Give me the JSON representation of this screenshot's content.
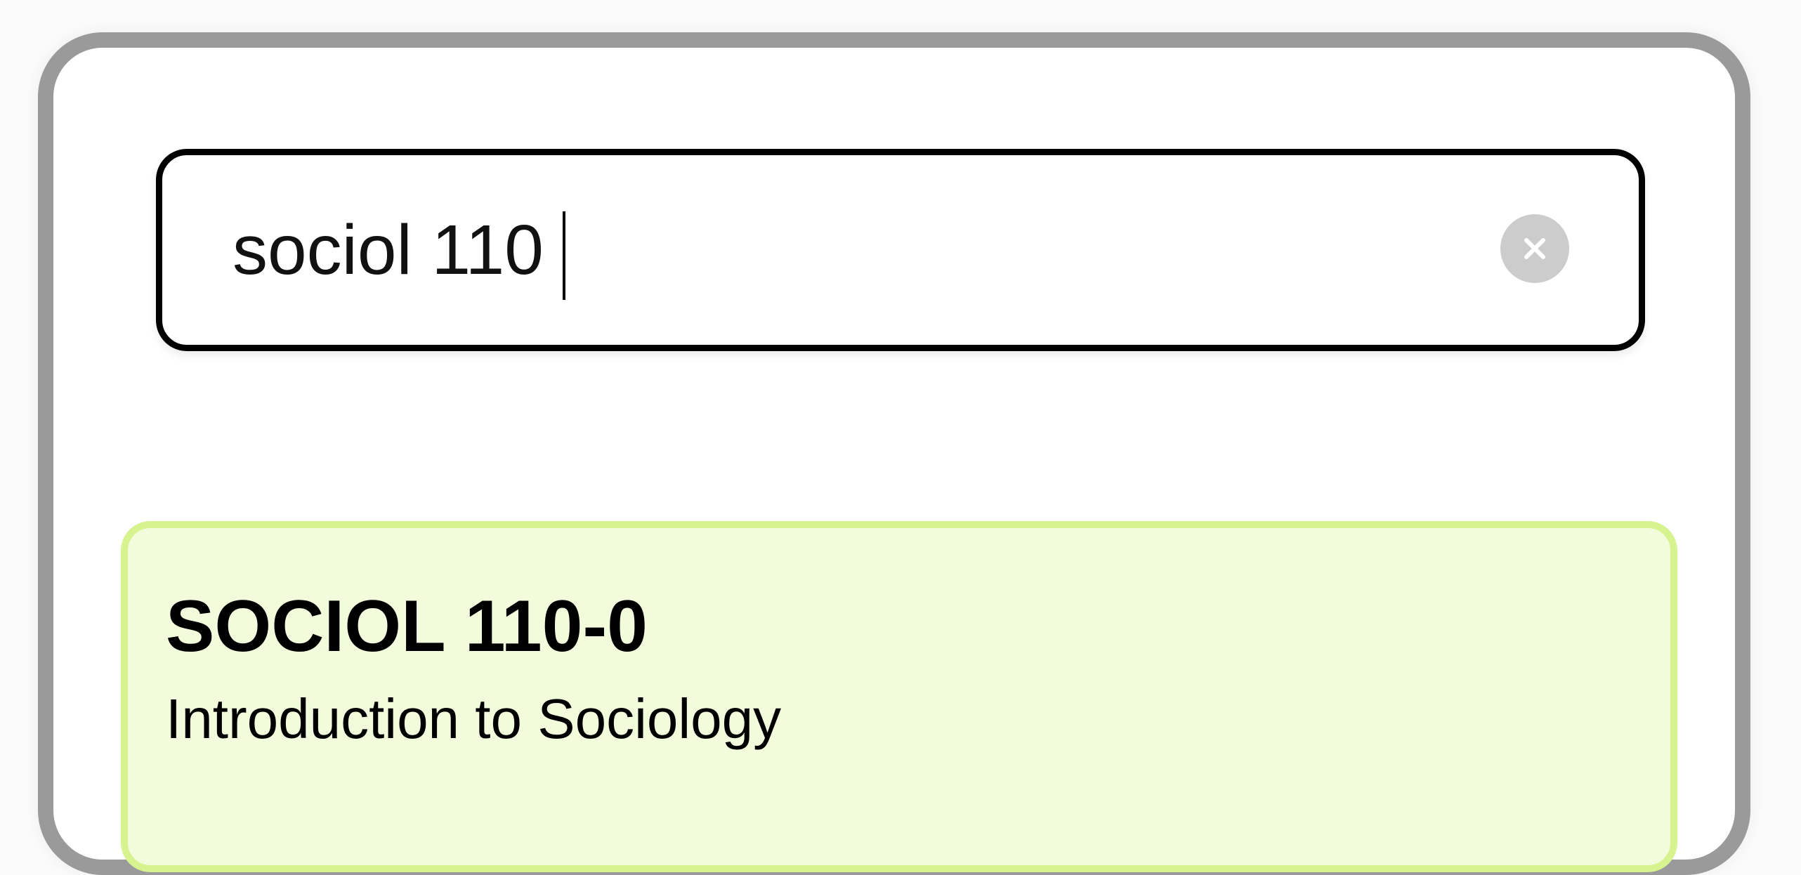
{
  "search": {
    "value": "sociol 110",
    "clear_icon": "close-icon"
  },
  "results": [
    {
      "code": "SOCIOL 110-0",
      "title": "Introduction to Sociology",
      "highlight_bg": "#f2fbdb",
      "highlight_border": "#d6f38f"
    }
  ]
}
